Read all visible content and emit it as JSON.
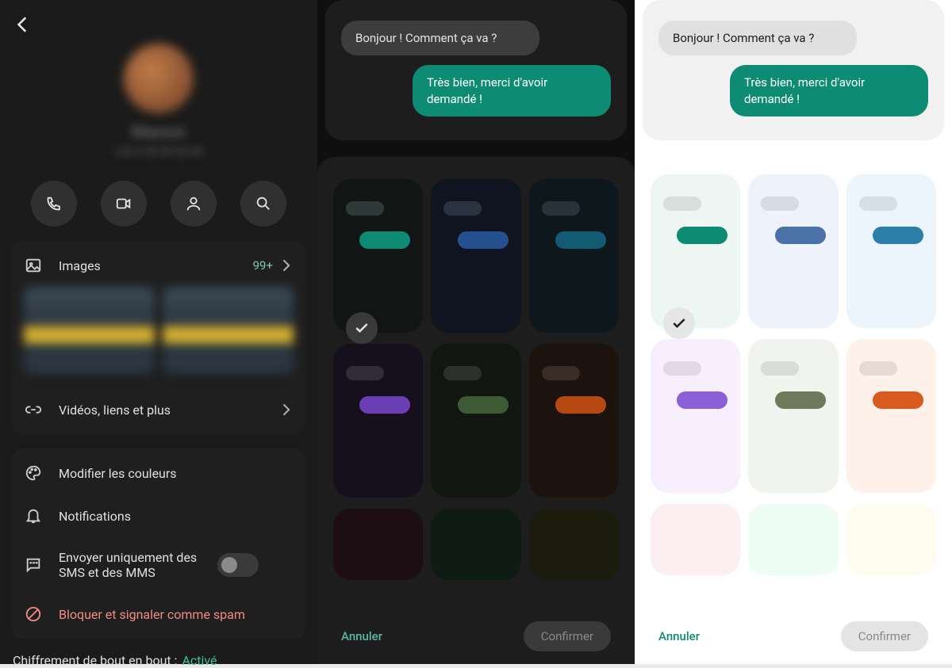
{
  "panel1": {
    "contact_name": "Manon",
    "contact_sub": "+33 6 00 00 00 00",
    "media_card": {
      "images_label": "Images",
      "images_count": "99+",
      "more_media_label": "Vidéos, liens et plus"
    },
    "options": {
      "colors_label": "Modifier les couleurs",
      "notifications_label": "Notifications",
      "sms_only_label": "Envoyer uniquement des SMS et des MMS",
      "block_label": "Bloquer et signaler comme spam"
    },
    "encryption_prefix": "Chiffrement de bout en bout : ",
    "encryption_status": "Activé"
  },
  "chat_preview": {
    "incoming": "Bonjour ! Comment ça va ?",
    "outgoing": "Très bien, merci d'avoir demandé !",
    "outgoing_color": "#0e8b73"
  },
  "swatches_dark": [
    {
      "bg": "#111615",
      "b1": "#2e3a37",
      "b2": "#0e8b73",
      "selected": true
    },
    {
      "bg": "#0f1420",
      "b1": "#2c3340",
      "b2": "#24508f",
      "selected": false
    },
    {
      "bg": "#0e171c",
      "b1": "#29343a",
      "b2": "#135a73",
      "selected": false
    },
    {
      "bg": "#16101c",
      "b1": "#322b3a",
      "b2": "#6b3fb4",
      "selected": false
    },
    {
      "bg": "#121611",
      "b1": "#2c322b",
      "b2": "#3e5a34",
      "selected": false
    },
    {
      "bg": "#1c120e",
      "b1": "#3a2d26",
      "b2": "#b44a12",
      "selected": false
    },
    {
      "bg": "#1c0e12",
      "b1": "#1c0e12",
      "b2": "#1c0e12",
      "selected": false
    },
    {
      "bg": "#0e1c14",
      "b1": "#0e1c14",
      "b2": "#0e1c14",
      "selected": false
    },
    {
      "bg": "#1c1c0e",
      "b1": "#1c1c0e",
      "b2": "#1c1c0e",
      "selected": false
    }
  ],
  "swatches_light": [
    {
      "bg": "#eef6f3",
      "b1": "#d7dedb",
      "b2": "#0e8b73",
      "selected": true
    },
    {
      "bg": "#eef2fb",
      "b1": "#d7dbe4",
      "b2": "#4a71a8",
      "selected": false
    },
    {
      "bg": "#ebf5fb",
      "b1": "#d5dfe5",
      "b2": "#2b7fa8",
      "selected": false
    },
    {
      "bg": "#f7effd",
      "b1": "#e1d8e8",
      "b2": "#8b5fd6",
      "selected": false
    },
    {
      "bg": "#f1f4ee",
      "b1": "#dadcd7",
      "b2": "#6f7a5d",
      "selected": false
    },
    {
      "bg": "#fdf1ea",
      "b1": "#e8dad2",
      "b2": "#d95a1f",
      "selected": false
    },
    {
      "bg": "#fdeef2",
      "b1": "#fdeef2",
      "b2": "#fdeef2",
      "selected": false
    },
    {
      "bg": "#eefdf3",
      "b1": "#eefdf3",
      "b2": "#eefdf3",
      "selected": false
    },
    {
      "bg": "#fdfcee",
      "b1": "#fdfcee",
      "b2": "#fdfcee",
      "selected": false
    }
  ],
  "footer": {
    "cancel": "Annuler",
    "confirm": "Confirmer"
  }
}
